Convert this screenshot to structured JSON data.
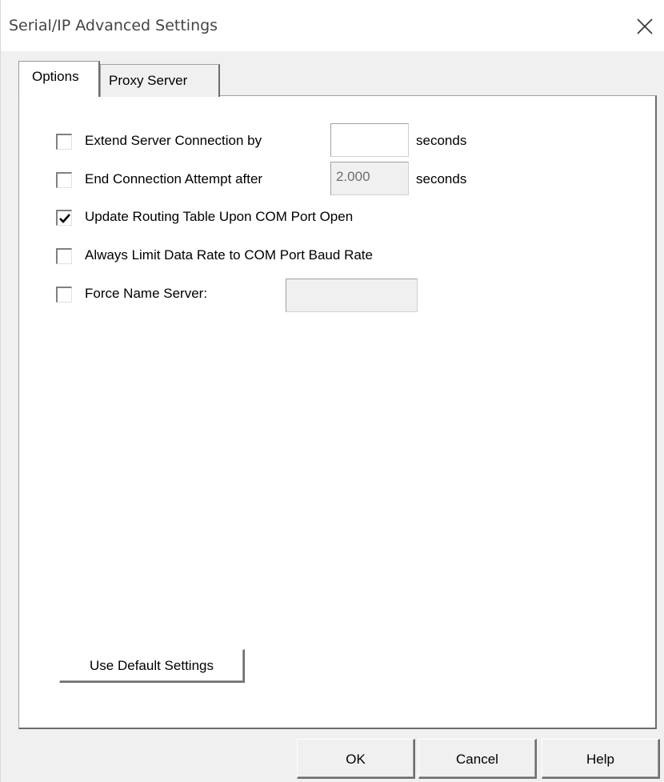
{
  "window": {
    "title": "Serial/IP Advanced Settings",
    "close_icon": "close-icon"
  },
  "tabs": [
    {
      "label": "Options",
      "selected": true
    },
    {
      "label": "Proxy Server",
      "selected": false
    }
  ],
  "options": {
    "extend_connection": {
      "label": "Extend Server Connection by",
      "checked": false,
      "value": "",
      "unit": "seconds"
    },
    "end_attempt": {
      "label": "End Connection Attempt after",
      "checked": false,
      "value": "2.000",
      "unit": "seconds"
    },
    "update_routing": {
      "label": "Update Routing Table Upon COM Port Open",
      "checked": true
    },
    "limit_rate": {
      "label": "Always Limit Data Rate to COM Port Baud Rate",
      "checked": false
    },
    "force_name_server": {
      "label": "Force Name Server:",
      "checked": false,
      "value": ""
    }
  },
  "buttons": {
    "use_default": "Use Default Settings",
    "ok": "OK",
    "cancel": "Cancel",
    "help": "Help"
  }
}
